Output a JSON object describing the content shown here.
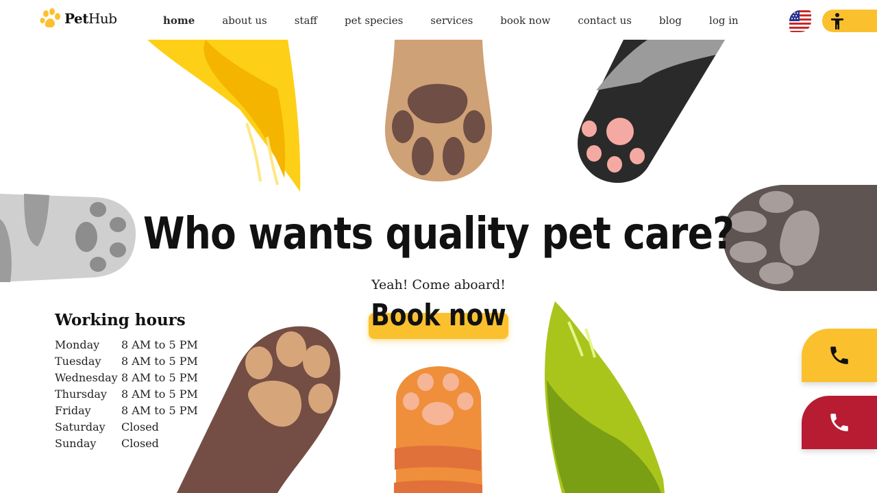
{
  "brand": {
    "name_bold": "Pet",
    "name_rest": "Hub"
  },
  "nav": {
    "items": [
      {
        "label": "home",
        "active": true
      },
      {
        "label": "about us",
        "active": false
      },
      {
        "label": "staff",
        "active": false
      },
      {
        "label": "pet species",
        "active": false
      },
      {
        "label": "services",
        "active": false
      },
      {
        "label": "book now",
        "active": false
      },
      {
        "label": "contact us",
        "active": false
      },
      {
        "label": "blog",
        "active": false
      },
      {
        "label": "log in",
        "active": false
      }
    ]
  },
  "language": {
    "icon": "us-flag-icon"
  },
  "accessibility": {
    "icon": "accessibility-icon"
  },
  "hero": {
    "title": "Who wants quality pet care?",
    "subtitle": "Yeah! Come aboard!",
    "cta_label": "Book now"
  },
  "hours": {
    "title": "Working hours",
    "rows": [
      {
        "day": "Monday",
        "time": "8 AM to 5 PM"
      },
      {
        "day": "Tuesday",
        "time": "8 AM to 5 PM"
      },
      {
        "day": "Wednesday",
        "time": "8 AM to 5 PM"
      },
      {
        "day": "Thursday",
        "time": "8 AM to 5 PM"
      },
      {
        "day": "Friday",
        "time": "8 AM to 5 PM"
      },
      {
        "day": "Saturday",
        "time": "Closed"
      },
      {
        "day": "Sunday",
        "time": "Closed"
      }
    ]
  },
  "phones": [
    {
      "icon": "phone-icon",
      "color": "#fbc02d"
    },
    {
      "icon": "phone-icon",
      "color": "#b71c33"
    }
  ],
  "colors": {
    "accent": "#fbc02d",
    "emergency": "#b71c33",
    "text": "#111111"
  }
}
